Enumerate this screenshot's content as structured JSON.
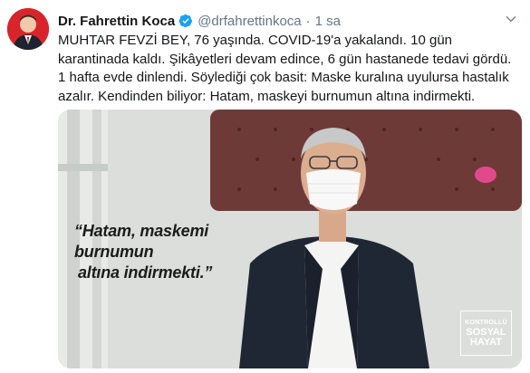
{
  "tweet": {
    "author_name": "Dr. Fahrettin Koca",
    "handle": "@drfahrettinkoca",
    "separator": "·",
    "time": "1 sa",
    "text": "MUHTAR FEVZİ BEY, 76 yaşında. COVID-19'a yakalandı. 10 gün karantinada kaldı. Şikâyetleri devam edince, 6 gün hastanede tedavi gördü. 1 hafta evde dinlendi. Söylediği çok basit: Maske kuralına uyulursa hastalık azalır. Kendinden biliyor: Hatam, maskeyi burnumun altına indirmekti.",
    "icons": {
      "verified": "verified-badge-icon",
      "menu": "chevron-down-icon"
    },
    "colors": {
      "verified": "#1da1f2",
      "secondary": "#657786"
    }
  },
  "media": {
    "quote_line1": "“Hatam, maskemi burnumun",
    "quote_line2": "altına indirmekti.”",
    "watermark_line1": "KONTROLLÜ",
    "watermark_line2": "SOSYAL",
    "watermark_line3": "HAYAT"
  }
}
